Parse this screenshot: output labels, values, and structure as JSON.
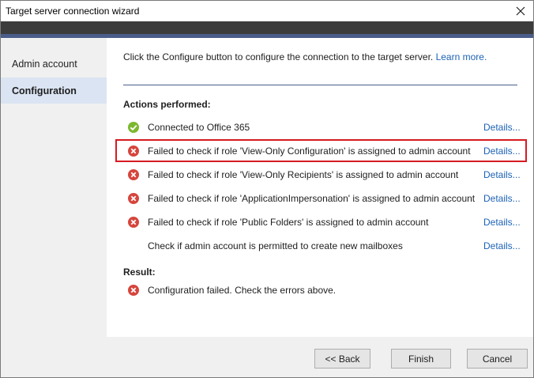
{
  "window": {
    "title": "Target server connection wizard",
    "close_icon": "close-icon"
  },
  "sidebar": {
    "items": [
      {
        "label": "Admin account",
        "selected": false
      },
      {
        "label": "Configuration",
        "selected": true
      }
    ]
  },
  "main": {
    "intro": "Click the Configure button to configure the connection to the target server.",
    "learn_more": "Learn more.",
    "actions_heading": "Actions performed:",
    "actions": [
      {
        "status": "success",
        "icon": "check-circle-icon",
        "text": "Connected to Office 365",
        "details": "Details..."
      },
      {
        "status": "error",
        "icon": "error-circle-icon",
        "text": "Failed to check if role 'View-Only Configuration' is assigned to admin account",
        "details": "Details..."
      },
      {
        "status": "error",
        "icon": "error-circle-icon",
        "text": "Failed to check if role 'View-Only Recipients' is assigned to admin account",
        "details": "Details..."
      },
      {
        "status": "error",
        "icon": "error-circle-icon",
        "text": "Failed to check if role 'ApplicationImpersonation' is assigned to admin account",
        "details": "Details..."
      },
      {
        "status": "error",
        "icon": "error-circle-icon",
        "text": "Failed to check if role 'Public Folders' is assigned to admin account",
        "details": "Details..."
      },
      {
        "status": "none",
        "icon": "",
        "text": "Check if admin account is permitted to create new mailboxes",
        "details": "Details..."
      }
    ],
    "result_heading": "Result:",
    "result": {
      "status": "error",
      "icon": "error-circle-icon",
      "text": "Configuration failed. Check the errors above."
    }
  },
  "footer": {
    "back_label": "<< Back",
    "finish_label": "Finish",
    "cancel_label": "Cancel"
  },
  "colors": {
    "accent": "#4a5d8a",
    "link": "#1c62b5",
    "error": "#d6453d",
    "success": "#7cb82f",
    "highlight": "#d71a21"
  }
}
